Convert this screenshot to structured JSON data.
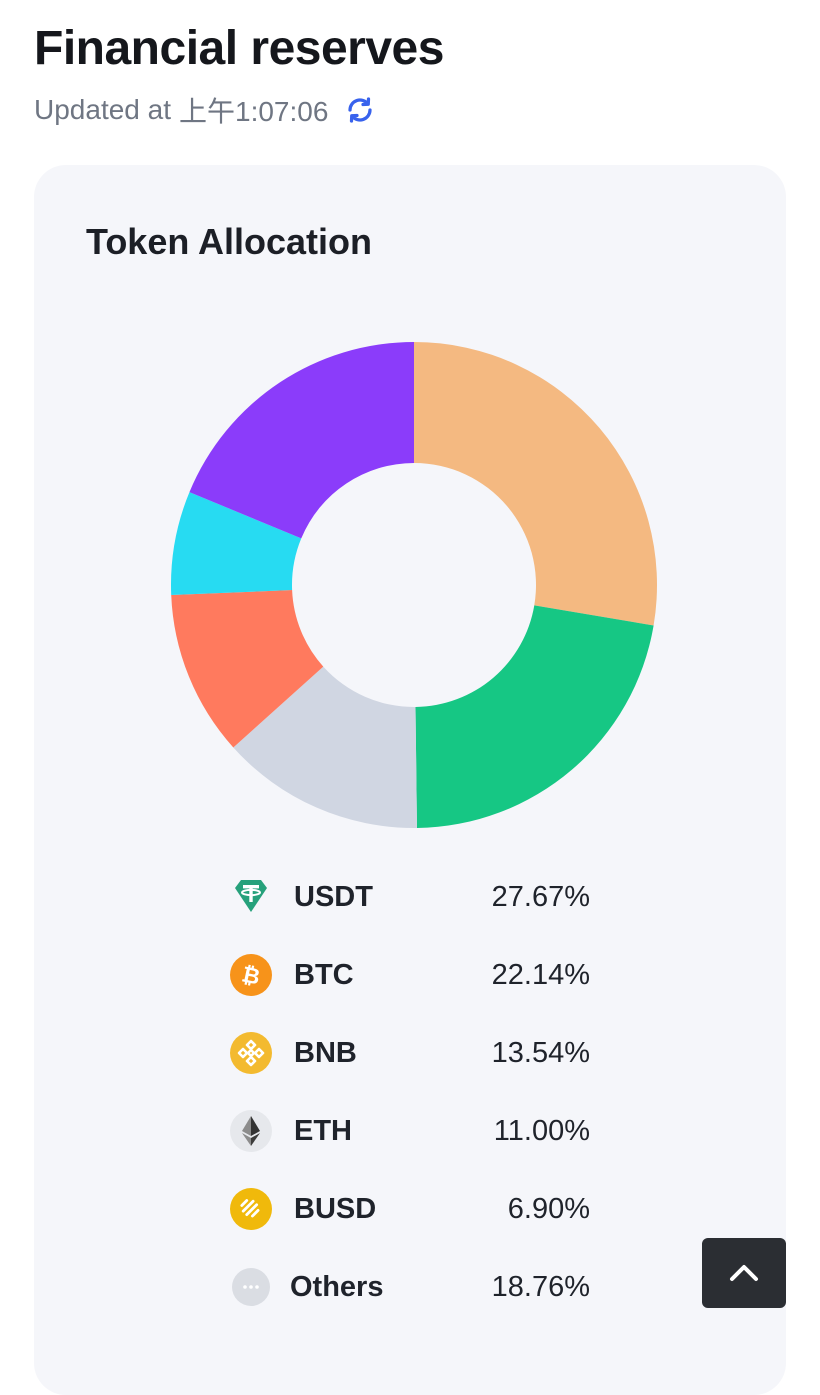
{
  "header": {
    "title": "Financial reserves",
    "updated_label": "Updated at",
    "updated_time": "上午1:07:06",
    "refresh_icon": "refresh-icon"
  },
  "card": {
    "title": "Token Allocation"
  },
  "colors": {
    "USDT": "#f4b981",
    "BTC": "#16c784",
    "BNB": "#d0d6e2",
    "ETH": "#ff7a5e",
    "BUSD": "#27dbf2",
    "Others": "#8b3cfa",
    "accent": "#3862ed",
    "card_bg": "#f5f6fa"
  },
  "legend": [
    {
      "symbol": "USDT",
      "percent": "27.67%",
      "icon": "usdt-icon"
    },
    {
      "symbol": "BTC",
      "percent": "22.14%",
      "icon": "btc-icon"
    },
    {
      "symbol": "BNB",
      "percent": "13.54%",
      "icon": "bnb-icon"
    },
    {
      "symbol": "ETH",
      "percent": "11.00%",
      "icon": "eth-icon"
    },
    {
      "symbol": "BUSD",
      "percent": "6.90%",
      "icon": "busd-icon"
    },
    {
      "symbol": "Others",
      "percent": "18.76%",
      "icon": "others-icon"
    }
  ],
  "chart_data": {
    "type": "pie",
    "title": "Token Allocation",
    "categories": [
      "USDT",
      "BTC",
      "BNB",
      "ETH",
      "BUSD",
      "Others"
    ],
    "values": [
      27.67,
      22.14,
      13.54,
      11.0,
      6.9,
      18.76
    ],
    "colors": [
      "#f4b981",
      "#16c784",
      "#d0d6e2",
      "#ff7a5e",
      "#27dbf2",
      "#8b3cfa"
    ],
    "donut": true
  },
  "scroll_top_icon": "chevron-up-icon"
}
